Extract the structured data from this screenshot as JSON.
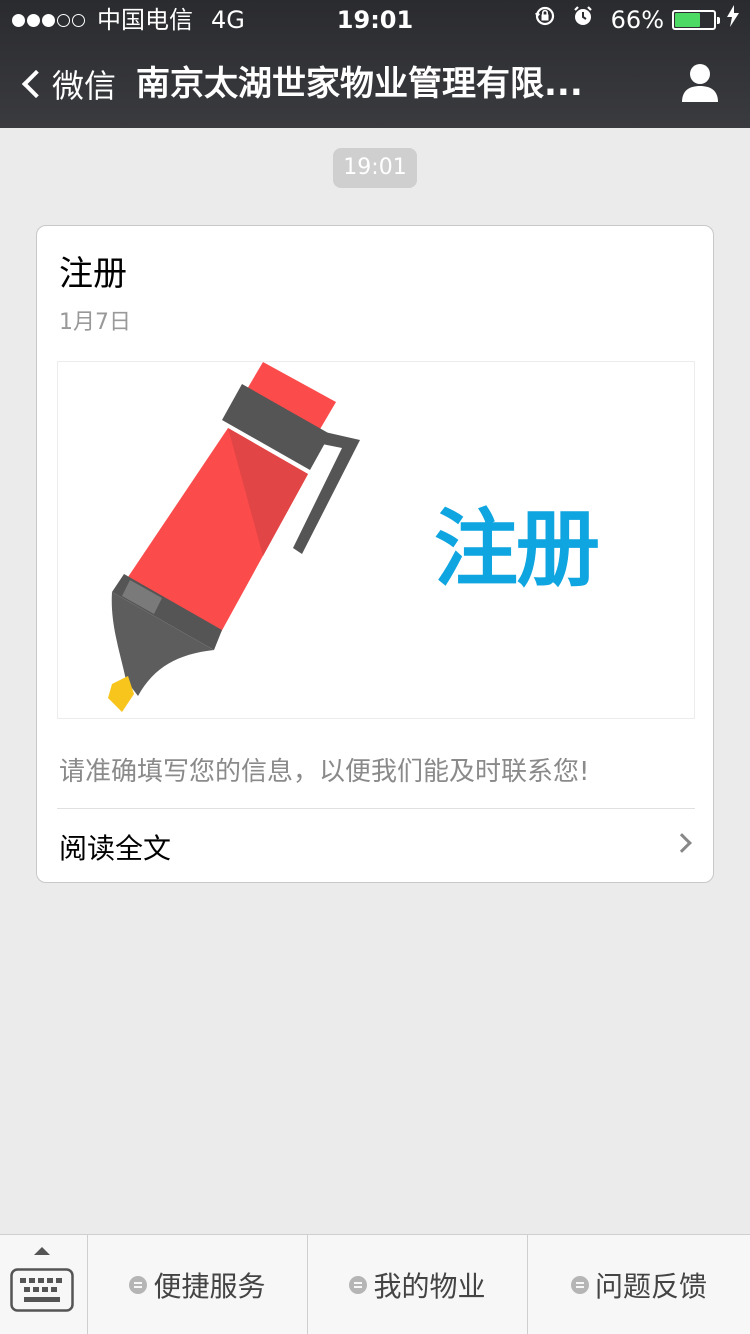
{
  "status_bar": {
    "carrier": "中国电信",
    "network": "4G",
    "time": "19:01",
    "battery_percent": "66%",
    "battery_level": 0.66,
    "signal_bars": [
      true,
      true,
      true,
      false,
      false
    ]
  },
  "nav": {
    "back_label": "微信",
    "title": "南京太湖世家物业管理有限..."
  },
  "chat": {
    "timestamp": "19:01"
  },
  "article": {
    "title": "注册",
    "date": "1月7日",
    "cover_text": "注册",
    "description": "请准确填写您的信息，以便我们能及时联系您!",
    "read_more": "阅读全文"
  },
  "menu": {
    "items": [
      {
        "label": "便捷服务"
      },
      {
        "label": "我的物业"
      },
      {
        "label": "问题反馈"
      }
    ]
  },
  "colors": {
    "nav_bg": "#2a2b2f",
    "battery_fill": "#4cd964",
    "cover_text": "#0ea5e0",
    "marker_red": "#fc4b4b",
    "marker_gray": "#555555",
    "marker_tip": "#f7c51c"
  }
}
